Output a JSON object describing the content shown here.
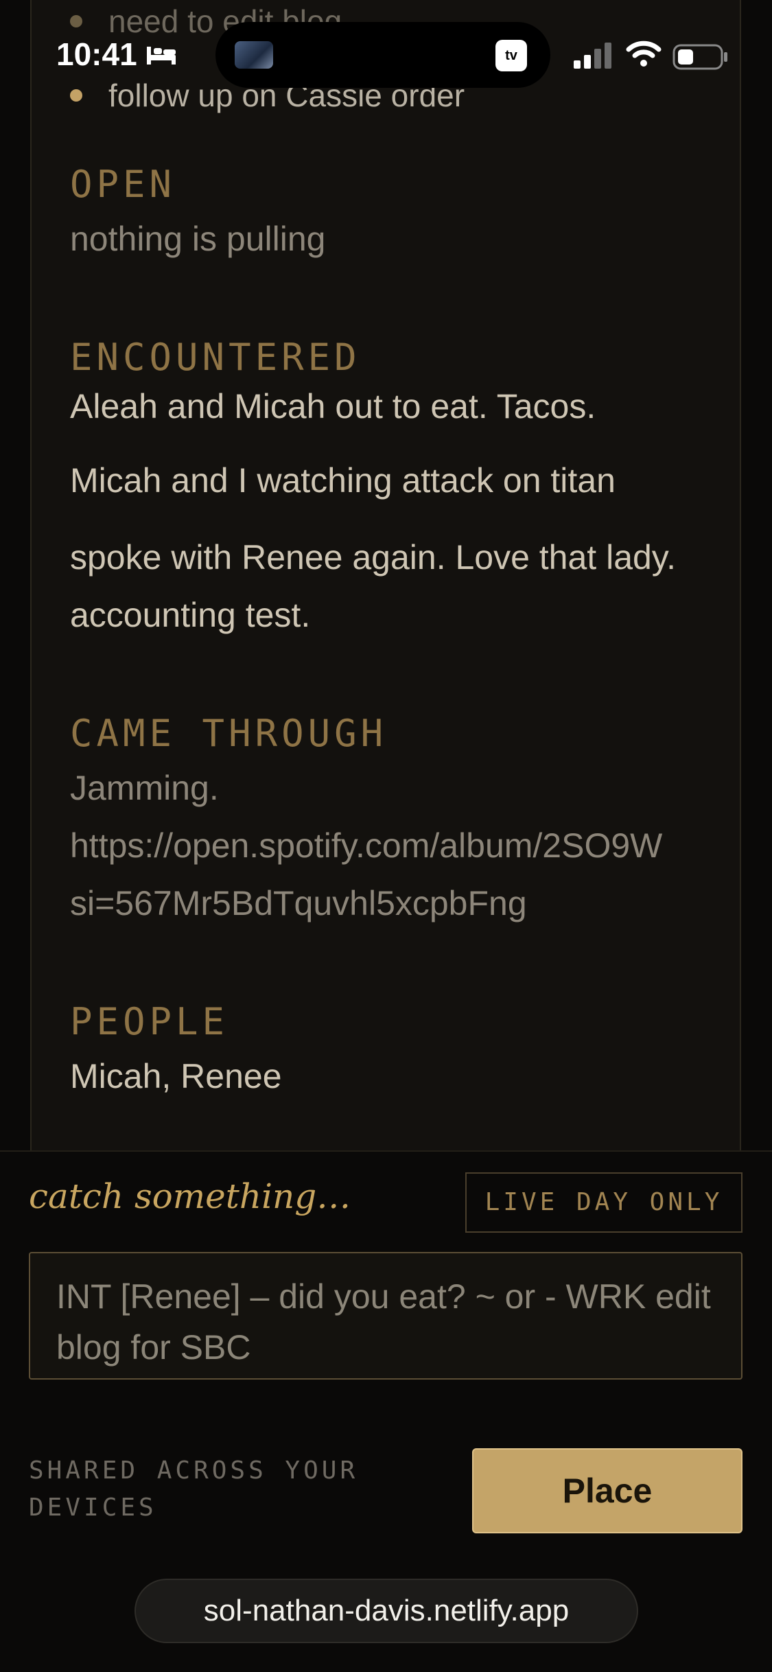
{
  "status_bar": {
    "time": "10:41",
    "now_playing_icon": "album-art-icon",
    "tv_badge": "tv",
    "icons": [
      "bed-icon",
      "signal-icon",
      "wifi-icon",
      "battery-icon"
    ]
  },
  "journal": {
    "bullets": [
      {
        "text": "need to edit blog"
      },
      {
        "text": "follow up on Cassie order"
      }
    ],
    "sections": {
      "open": {
        "heading": "OPEN",
        "entries": [
          "nothing is pulling"
        ]
      },
      "encountered": {
        "heading": "ENCOUNTERED",
        "entries": [
          "Aleah and Micah out to eat. Tacos.",
          "Micah and I watching attack on titan",
          "spoke with Renee again. Love that lady.",
          "accounting test."
        ]
      },
      "came_through": {
        "heading": "CAME THROUGH",
        "entries": [
          "Jamming.",
          "https://open.spotify.com/album/2SO9W",
          "si=567Mr5BdTquvhl5xcpbFng"
        ]
      },
      "people": {
        "heading": "PEOPLE",
        "entries": [
          "Micah, Renee"
        ]
      }
    }
  },
  "capture": {
    "label": "catch something…",
    "live_day_button": "LIVE DAY ONLY",
    "input_placeholder": "INT [Renee] – did you eat? ~  or  - WRK edit blog for SBC",
    "shared_note": "SHARED ACROSS YOUR DEVICES",
    "place_button": "Place"
  },
  "browser": {
    "url": "sol-nathan-davis.netlify.app"
  },
  "colors": {
    "accent_gold": "#c4a468",
    "section_heading": "#8f7446",
    "background": "#0a0908"
  }
}
